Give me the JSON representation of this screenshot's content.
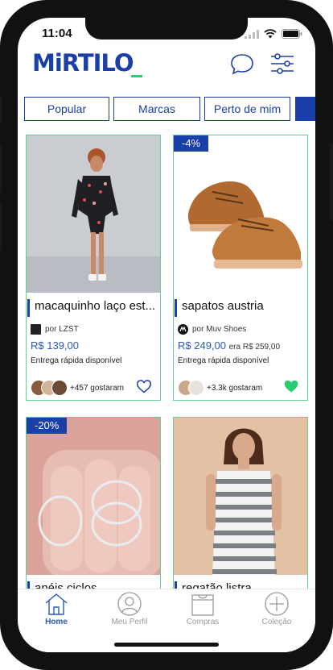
{
  "status_bar": {
    "time": "11:04"
  },
  "header": {
    "logo_text": "MiRTILO"
  },
  "tabs": [
    {
      "label": "Popular"
    },
    {
      "label": "Marcas"
    },
    {
      "label": "Perto de mim"
    },
    {
      "label": ""
    }
  ],
  "products": [
    {
      "title": "macaquinho laço est...",
      "seller": "por LZST",
      "price": "R$ 139,00",
      "old_price": "",
      "delivery": "Entrega rápida disponível",
      "likes": "+457 gostaram",
      "liked": false
    },
    {
      "badge": "-4%",
      "title": "sapatos austria",
      "seller": "por Muv Shoes",
      "price": "R$ 249,00",
      "old_price": "era R$ 259,00",
      "delivery": "Entrega rápida disponível",
      "likes": "+3.3k gostaram",
      "liked": true
    },
    {
      "badge": "-20%",
      "title": "anéis ciclos"
    },
    {
      "title": "regatão listra"
    }
  ],
  "bottom_nav": [
    {
      "label": "Home",
      "icon": "home-icon",
      "active": true
    },
    {
      "label": "Meu Perfil",
      "icon": "profile-icon",
      "active": false
    },
    {
      "label": "Compras",
      "icon": "shopping-bag-icon",
      "active": false
    },
    {
      "label": "Coleção",
      "icon": "plus-circle-icon",
      "active": false
    }
  ],
  "colors": {
    "brand": "#1a3fa8",
    "accent_green": "#2ecc71",
    "card_border": "#5fd38d"
  }
}
